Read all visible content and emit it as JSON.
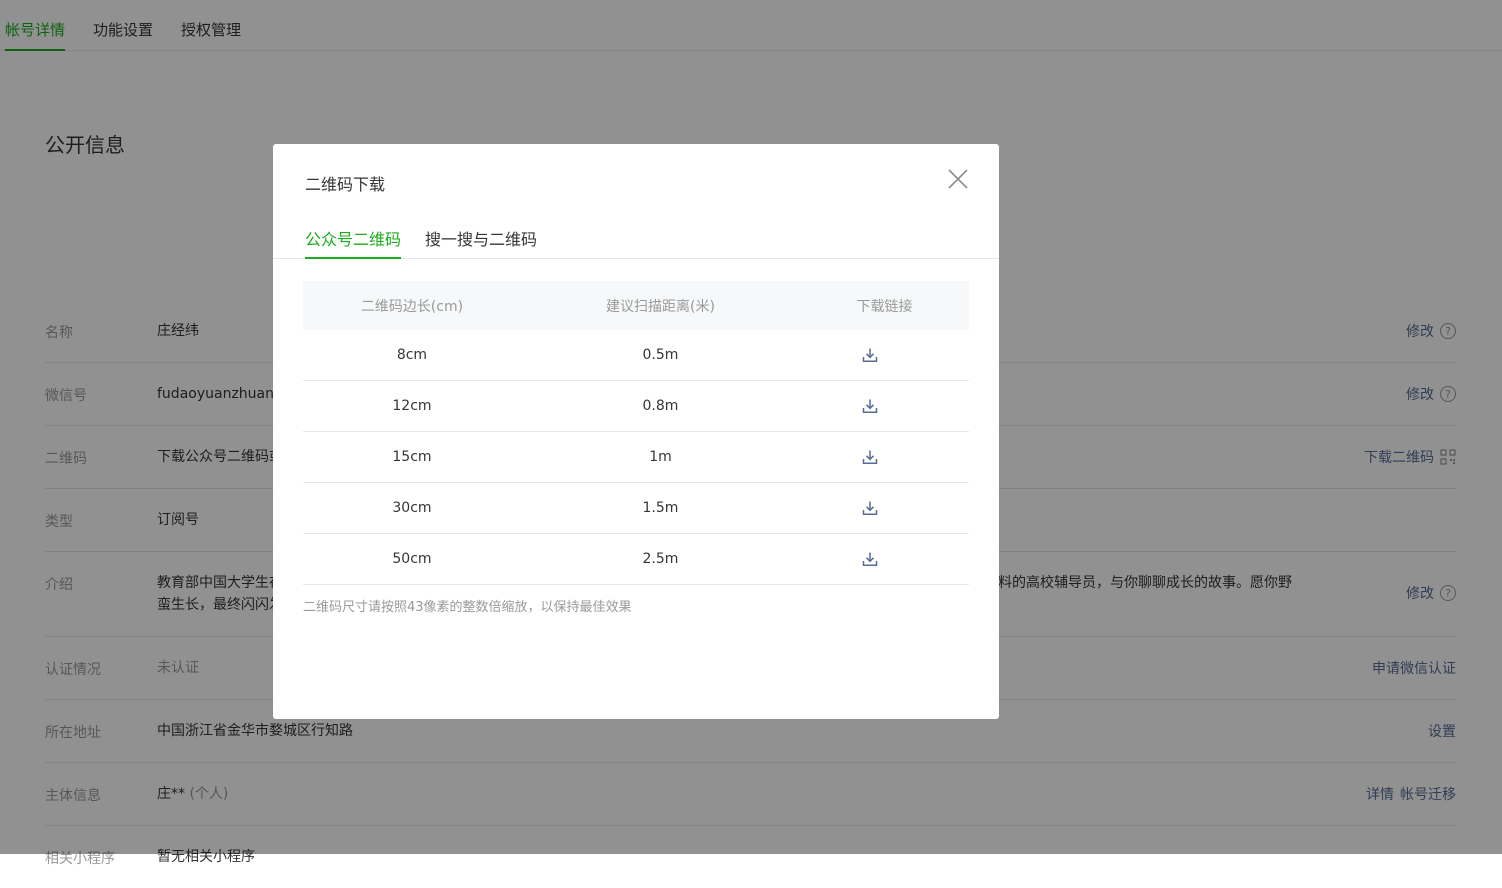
{
  "top_tabs": [
    {
      "label": "帐号详情",
      "active": true
    },
    {
      "label": "功能设置",
      "active": false
    },
    {
      "label": "授权管理",
      "active": false
    }
  ],
  "section_title": "公开信息",
  "rows": [
    {
      "label": "名称",
      "value": "庄经纬",
      "action": "修改"
    },
    {
      "label": "微信号",
      "value": "fudaoyuanzhuang",
      "action": "修改"
    },
    {
      "label": "二维码",
      "value": "下载公众号二维码或",
      "action": "下载二维码"
    },
    {
      "label": "类型",
      "value": "订阅号",
      "action": ""
    },
    {
      "label": "介绍",
      "value_left_1": "教育部中国大学生在",
      "value_left_2": "蛮生长，最终闪闪发",
      "value_right": "料的高校辅导员，与你聊聊成长的故事。愿你野",
      "action": "修改"
    },
    {
      "label": "认证情况",
      "value": "未认证",
      "action": "申请微信认证"
    },
    {
      "label": "所在地址",
      "value": "中国浙江省金华市婺城区行知路",
      "action": "设置"
    },
    {
      "label": "主体信息",
      "value": "庄**",
      "value_suffix": "(个人)",
      "action_1": "详情",
      "action_2": "帐号迁移"
    },
    {
      "label": "相关小程序",
      "value": "暂无相关小程序",
      "action": ""
    }
  ],
  "colors": {
    "accent": "#1aad19",
    "link": "#576b95",
    "muted": "#9a9a9a",
    "mask": "rgba(0,0,0,0.43)"
  },
  "icons": [
    "help-icon",
    "qrcode-icon",
    "close-icon",
    "download-icon"
  ],
  "dialog": {
    "title": "二维码下载",
    "tabs": [
      {
        "label": "公众号二维码",
        "active": true
      },
      {
        "label": "搜一搜与二维码",
        "active": false
      }
    ],
    "table": {
      "headers": [
        "二维码边长(cm)",
        "建议扫描距离(米)",
        "下载链接"
      ],
      "rows": [
        {
          "size": "8cm",
          "distance": "0.5m"
        },
        {
          "size": "12cm",
          "distance": "0.8m"
        },
        {
          "size": "15cm",
          "distance": "1m"
        },
        {
          "size": "30cm",
          "distance": "1.5m"
        },
        {
          "size": "50cm",
          "distance": "2.5m"
        }
      ]
    },
    "footnote": "二维码尺寸请按照43像素的整数倍缩放，以保持最佳效果"
  }
}
